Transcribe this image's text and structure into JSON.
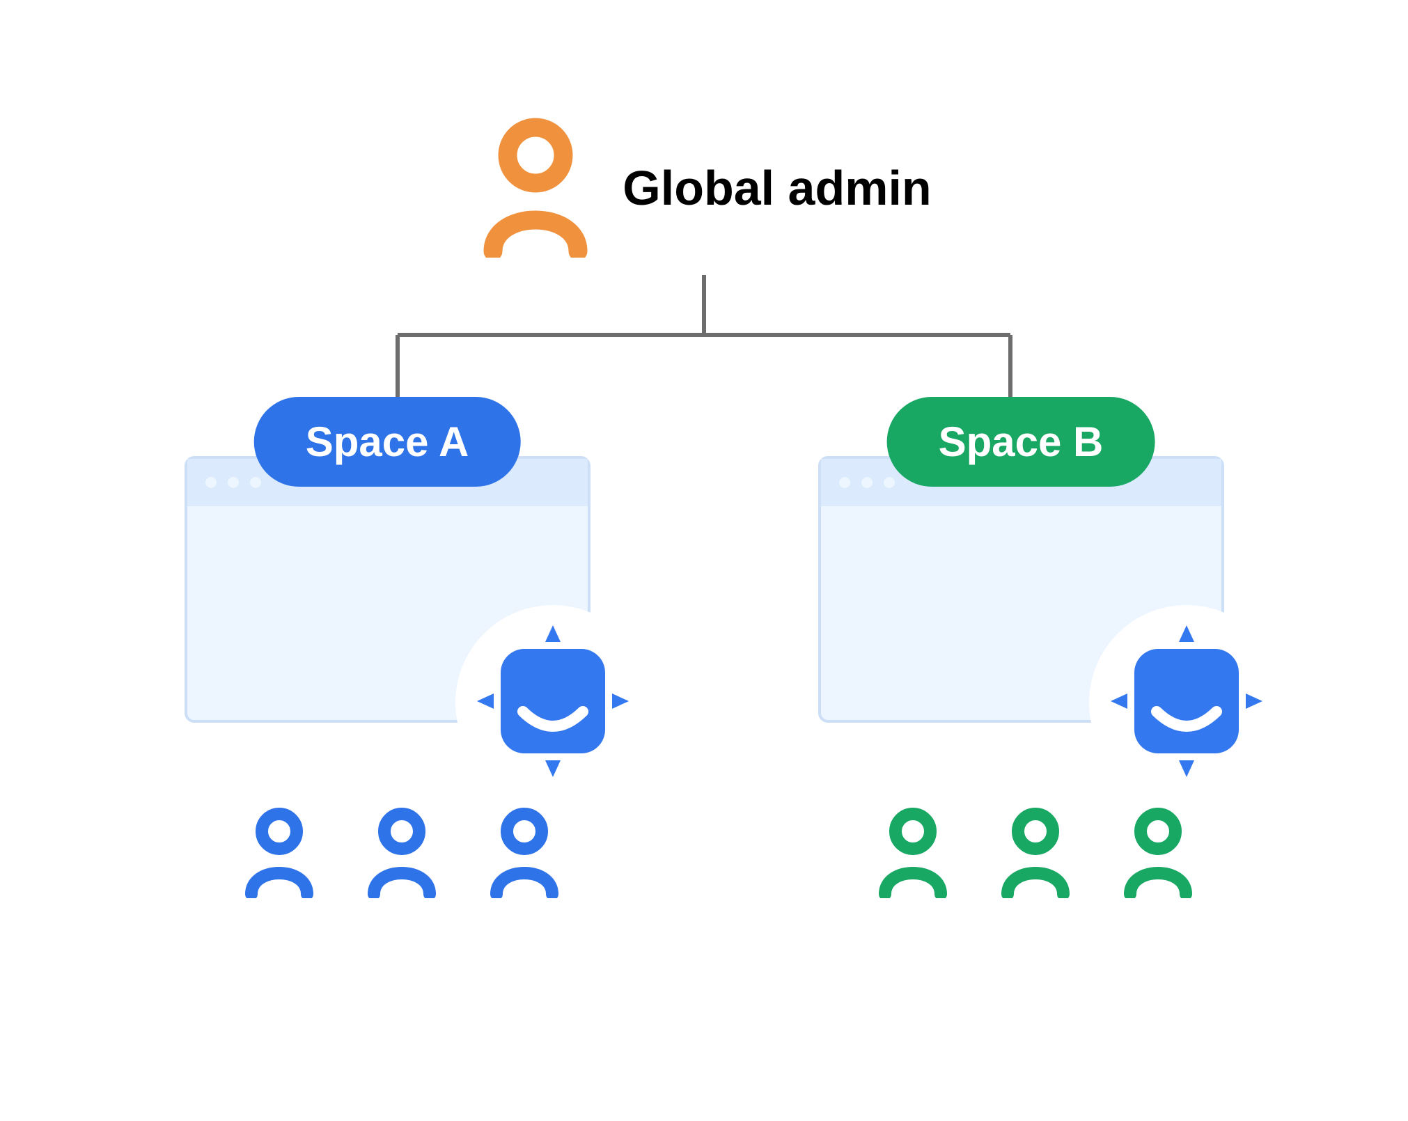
{
  "admin": {
    "label": "Global admin",
    "icon_color": "#F0913E"
  },
  "connector_color": "#6D6D6D",
  "spaces": [
    {
      "id": "space-a",
      "label": "Space A",
      "pill_color": "#2E73E8",
      "user_color": "#2E73E8",
      "user_count": 3
    },
    {
      "id": "space-b",
      "label": "Space B",
      "pill_color": "#18A864",
      "user_color": "#18A864",
      "user_count": 3
    }
  ],
  "bot_color": "#3478F0"
}
